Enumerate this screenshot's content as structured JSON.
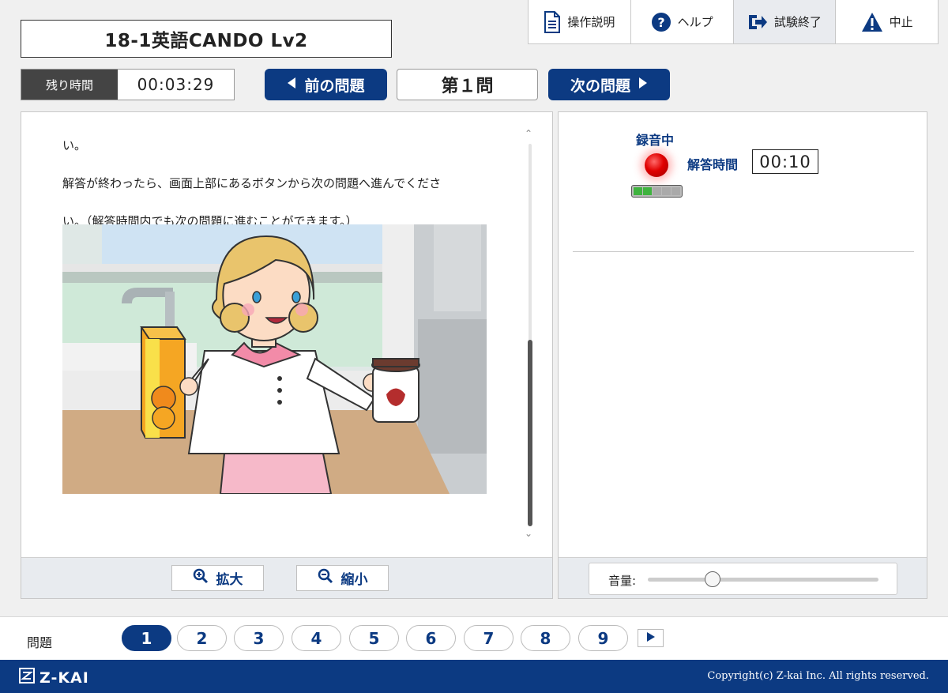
{
  "title": "18-1英語CANDO Lv2",
  "toolbar": {
    "instructions": "操作説明",
    "help": "ヘルプ",
    "exit": "試験終了",
    "abort": "中止"
  },
  "timer": {
    "label": "残り時間",
    "value": "00:03:29"
  },
  "nav": {
    "prev": "前の問題",
    "question": "第１問",
    "next": "次の問題"
  },
  "question": {
    "lines": [
      "い。",
      "解答が終わったら、画面上部にあるボタンから次の問題へ進んでくださ",
      "い。（解答時間内でも次の問題に進むことができます。）"
    ]
  },
  "zoom": {
    "in": "拡大",
    "out": "縮小"
  },
  "recording": {
    "label": "録音中",
    "answer_label": "解答時間",
    "answer_time": "00:10",
    "level": 0.4
  },
  "volume": {
    "label": "音量:",
    "value": 0.28
  },
  "pager": {
    "label": "問題",
    "pages": [
      "1",
      "2",
      "3",
      "4",
      "5",
      "6",
      "7",
      "8",
      "9"
    ],
    "current": "1"
  },
  "footer": {
    "logo": "Z-KAI",
    "copyright": "Copyright(c) Z-kai Inc. All rights reserved."
  },
  "colors": {
    "primary": "#0c3a82",
    "record": "#e00000",
    "meter": "#3fb33f"
  }
}
